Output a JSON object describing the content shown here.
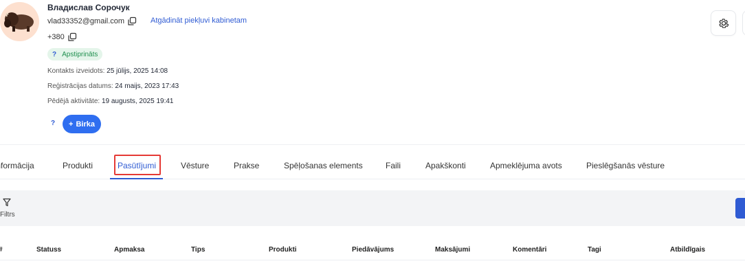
{
  "contact": {
    "name": "Владислав Сорочук",
    "email": "vlad33352@gmail.com",
    "reset_link": "Atgādināt piekļuvi kabinetam",
    "phone": "+380",
    "badge_help": "?",
    "status_badge": "Apstiprināts",
    "created_label": "Kontakts izveidots:",
    "created_value": "25 jūlijs, 2025 14:08",
    "registered_label": "Reģistrācijas datums:",
    "registered_value": "24 maijs, 2023 17:43",
    "last_activity_label": "Pēdējā aktivitāte:",
    "last_activity_value": "19 augusts, 2025 19:41",
    "tag_help": "?",
    "tag_button": "Birka",
    "tag_button_icon": "+"
  },
  "tabs": [
    {
      "label": "Informācija"
    },
    {
      "label": "Produkti"
    },
    {
      "label": "Pasūtījumi",
      "active": true
    },
    {
      "label": "Vēsture"
    },
    {
      "label": "Prakse"
    },
    {
      "label": "Spēļošanas elements"
    },
    {
      "label": "Faili"
    },
    {
      "label": "Apakškonti"
    },
    {
      "label": "Apmeklējuma avots"
    },
    {
      "label": "Pieslēgšanās vēsture"
    }
  ],
  "filter": {
    "label": "Filtrs",
    "icon": "filter-icon"
  },
  "table": {
    "columns": [
      "#",
      "Statuss",
      "Apmaksa",
      "Tips",
      "Produkti",
      "Piedāvājums",
      "Maksājumi",
      "Komentāri",
      "Tagi",
      "Atbildīgais"
    ]
  },
  "colors": {
    "accent": "#2f5bd3",
    "button": "#2f6ef0",
    "badge_bg": "#e4f5ea",
    "badge_text": "#1f8f4e",
    "highlight": "#e53935"
  },
  "icons": {
    "avatar": "bison-avatar",
    "copy": "copy-icon",
    "settings": "gear-icon"
  }
}
